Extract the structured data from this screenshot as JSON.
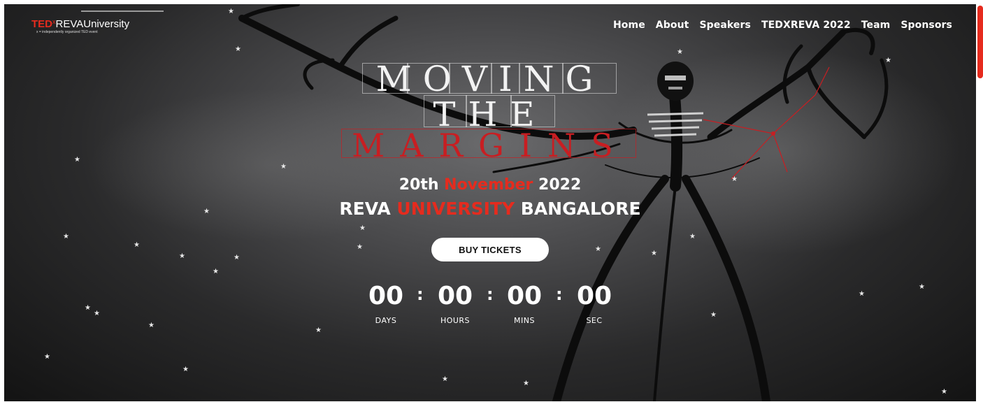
{
  "logo": {
    "ted": "TED",
    "x": "x",
    "name": "REVAUniversity",
    "tagline": "x = independently organized TED event"
  },
  "nav": [
    "Home",
    "About",
    "Speakers",
    "TEDXREVA 2022",
    "Team",
    "Sponsors"
  ],
  "hero": {
    "title_line1": "MOVING",
    "title_line2": "THE",
    "title_line3": "MARGINS",
    "date_pre": "20th ",
    "date_month": "November",
    "date_post": " 2022",
    "venue_pre": "REVA ",
    "venue_mid": "UNIVERSITY",
    "venue_post": " BANGALORE",
    "cta": "BUY TICKETS"
  },
  "countdown": {
    "separator": ":",
    "days": "00",
    "days_label": "DAYS",
    "hours": "00",
    "hours_label": "HOURS",
    "mins": "00",
    "mins_label": "MINS",
    "sec": "00",
    "sec_label": "SEC"
  },
  "colors": {
    "accent": "#e62b1e",
    "background": "#2a2a2b"
  }
}
